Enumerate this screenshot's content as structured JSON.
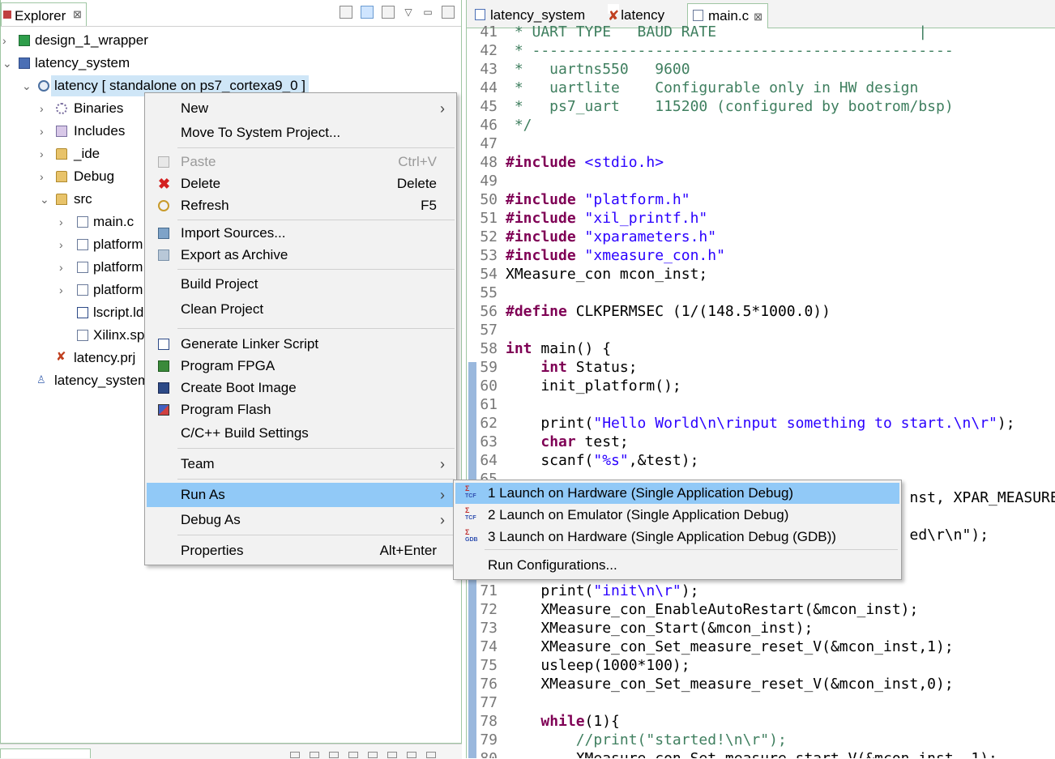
{
  "explorer": {
    "tab_label": "Explorer",
    "tab_close": "⊠",
    "tree": [
      {
        "label": "design_1_wrapper",
        "icon": "project-icon"
      },
      {
        "label": "latency_system",
        "icon": "system-project-icon"
      },
      {
        "label": "latency [ standalone on ps7_cortexa9_0 ]",
        "icon": "app-project-icon"
      },
      {
        "label": "Binaries",
        "icon": "binaries-icon"
      },
      {
        "label": "Includes",
        "icon": "includes-icon"
      },
      {
        "label": "_ide",
        "icon": "folder-icon"
      },
      {
        "label": "Debug",
        "icon": "folder-icon"
      },
      {
        "label": "src",
        "icon": "folder-icon"
      },
      {
        "label": "main.c",
        "icon": "c-file-icon"
      },
      {
        "label": "platform",
        "icon": "c-file-icon"
      },
      {
        "label": "platform",
        "icon": "c-file-icon"
      },
      {
        "label": "platform",
        "icon": "h-file-icon"
      },
      {
        "label": "lscript.ld",
        "icon": "linker-script-icon"
      },
      {
        "label": "Xilinx.sp",
        "icon": "file-icon"
      },
      {
        "label": "latency.prj",
        "icon": "prj-icon"
      },
      {
        "label": "latency_system",
        "icon": "system-icon"
      }
    ]
  },
  "editor": {
    "tabs": [
      {
        "label": "latency_system"
      },
      {
        "label": "latency"
      },
      {
        "label": "main.c",
        "close": "⊠"
      }
    ],
    "lines": [
      {
        "n": "41",
        "t": " * UART TYPE   BAUD RATE                       |"
      },
      {
        "n": "42",
        "t": " * ------------------------------------------------"
      },
      {
        "n": "43",
        "t": " *   uartns550   9600"
      },
      {
        "n": "44",
        "t": " *   uartlite    Configurable only in HW design"
      },
      {
        "n": "45",
        "t": " *   ps7_uart    115200 (configured by bootrom/bsp)"
      },
      {
        "n": "46",
        "t": " */"
      },
      {
        "n": "47",
        "t": ""
      },
      {
        "n": "48",
        "t": "#include <stdio.h>"
      },
      {
        "n": "49",
        "t": ""
      },
      {
        "n": "50",
        "t": "#include \"platform.h\""
      },
      {
        "n": "51",
        "t": "#include \"xil_printf.h\""
      },
      {
        "n": "52",
        "t": "#include \"xparameters.h\""
      },
      {
        "n": "53",
        "t": "#include \"xmeasure_con.h\""
      },
      {
        "n": "54",
        "t": "XMeasure_con mcon_inst;"
      },
      {
        "n": "55",
        "t": ""
      },
      {
        "n": "56",
        "t": "#define CLKPERMSEC (1/(148.5*1000.0))"
      },
      {
        "n": "57",
        "t": ""
      },
      {
        "n": "58",
        "t": "int main() {"
      },
      {
        "n": "59",
        "t": "    int Status;"
      },
      {
        "n": "60",
        "t": "    init_platform();"
      },
      {
        "n": "61",
        "t": ""
      },
      {
        "n": "62",
        "t": "    print(\"Hello World\\n\\rinput something to start.\\n\\r\");"
      },
      {
        "n": "63",
        "t": "    char test;"
      },
      {
        "n": "64",
        "t": "    scanf(\"%s\",&test);"
      },
      {
        "n": "65",
        "t": ""
      },
      {
        "n": "66",
        "t": "                                              nst, XPAR_MEASURE_"
      },
      {
        "n": "67",
        "t": ""
      },
      {
        "n": "68",
        "t": "                                              ed\\r\\n\");"
      },
      {
        "n": "69",
        "t": ""
      },
      {
        "n": "70",
        "t": ""
      },
      {
        "n": "71",
        "t": "    print(\"init\\n\\r\");"
      },
      {
        "n": "72",
        "t": "    XMeasure_con_EnableAutoRestart(&mcon_inst);"
      },
      {
        "n": "73",
        "t": "    XMeasure_con_Start(&mcon_inst);"
      },
      {
        "n": "74",
        "t": "    XMeasure_con_Set_measure_reset_V(&mcon_inst,1);"
      },
      {
        "n": "75",
        "t": "    usleep(1000*100);"
      },
      {
        "n": "76",
        "t": "    XMeasure_con_Set_measure_reset_V(&mcon_inst,0);"
      },
      {
        "n": "77",
        "t": ""
      },
      {
        "n": "78",
        "t": "    while(1){"
      },
      {
        "n": "79",
        "t": "        //print(\"started!\\n\\r\");"
      },
      {
        "n": "80",
        "t": "        XMeasure_con_Set_measure_start_V(&mcon_inst, 1);"
      }
    ]
  },
  "context_menu": {
    "new": "New",
    "move_to_system": "Move To System Project...",
    "paste": "Paste",
    "paste_shortcut": "Ctrl+V",
    "delete": "Delete",
    "delete_shortcut": "Delete",
    "refresh": "Refresh",
    "refresh_shortcut": "F5",
    "import_sources": "Import Sources...",
    "export_archive": "Export as Archive",
    "build_project": "Build Project",
    "clean_project": "Clean Project",
    "generate_linker": "Generate Linker Script",
    "program_fpga": "Program FPGA",
    "create_boot_image": "Create Boot Image",
    "program_flash": "Program Flash",
    "cpp_build_settings": "C/C++ Build Settings",
    "team": "Team",
    "run_as": "Run As",
    "debug_as": "Debug As",
    "properties": "Properties",
    "properties_shortcut": "Alt+Enter",
    "arrow": "›"
  },
  "run_as_submenu": {
    "items": [
      {
        "label": "1 Launch on Hardware (Single Application Debug)",
        "icon_top": "Σ",
        "icon_sub": "TCF"
      },
      {
        "label": "2 Launch on Emulator (Single Application Debug)",
        "icon_top": "Σ",
        "icon_sub": "TCF"
      },
      {
        "label": "3 Launch on Hardware (Single Application Debug (GDB))",
        "icon_top": "Σ",
        "icon_sub": "GDB"
      }
    ],
    "run_configurations": "Run Configurations..."
  }
}
